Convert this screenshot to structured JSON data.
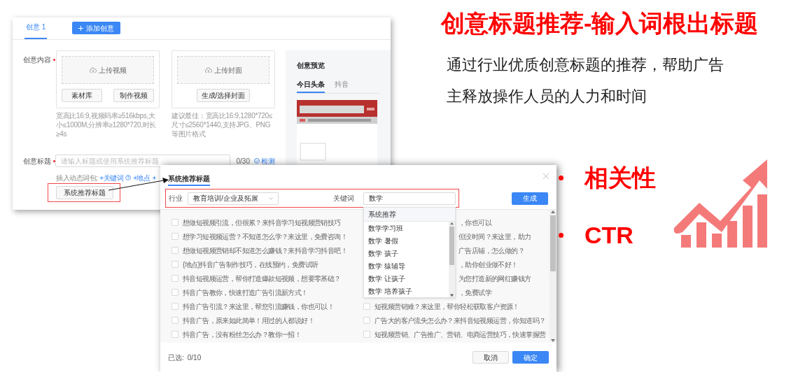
{
  "slide": {
    "title": "创意标题推荐-输入词根出标题",
    "description": "通过行业优质创意标题的推荐，帮助广告主释放操作人员的人力和时间",
    "bullets": [
      "相关性",
      "CTR"
    ]
  },
  "editor": {
    "tabs": [
      {
        "label": "创意 1",
        "selected": true
      }
    ],
    "add_button": "添加创意",
    "content_label": "创意内容",
    "content_required": true,
    "upload_cards": [
      {
        "upload_label": "上传视频",
        "buttons": [
          "素材库",
          "制作视频"
        ],
        "hint": "宽高比16:9,视频码率≥516kbps,大小≤1000M,分辨率≥1280*720,时长≥4s"
      },
      {
        "upload_label": "上传封面",
        "buttons": [
          "生成/选择封面"
        ],
        "hint": "建议最佳：宽高比16:9,1280*720≤尺寸≤2560*1440,支持JPG、PNG等图片格式"
      }
    ],
    "preview": {
      "title": "创意预览",
      "tabs": [
        {
          "label": "今日头条",
          "selected": true
        },
        {
          "label": "抖音",
          "selected": false
        }
      ]
    },
    "title_field": {
      "label": "创意标题",
      "required": true,
      "placeholder": "请输入标题或使用系统推荐标题",
      "counter": "0/30",
      "check_link": "检测"
    },
    "insert": {
      "label": "插入动态词包:",
      "links": [
        "+关键词",
        "+地点",
        "+"
      ]
    },
    "recommend_button": "系统推荐标题"
  },
  "dialog": {
    "title": "系统推荐标题",
    "industry_label": "行业",
    "industry_value": "教育培训/企业及拓展",
    "keyword_label": "关键词",
    "keyword_value": "数学",
    "generate_button": "生成",
    "suggestions": {
      "header": "系统推荐",
      "items": [
        "数学学习班",
        "数学 暑假",
        "数学 孩子",
        "数学 猿辅导",
        "数学 让孩子",
        "数学 培养孩子"
      ]
    },
    "titles_left": [
      {
        "text": "想做短视频引流，但很累？来抖音学习短视频营销技巧",
        "checked": false
      },
      {
        "text": "想学习短视频运营？不知道怎么学？来这里，免费咨询！",
        "checked": false
      },
      {
        "text": "想做短视频营销却不知道怎么赚钱？来抖音学习抖音吧！",
        "checked": false
      },
      {
        "text": "{地点}抖音广告制作技巧，在线预约，免费试听",
        "checked": false
      },
      {
        "text": "抖音短视频运营，帮你打造爆款短视频，想要零基础？",
        "checked": false
      },
      {
        "text": "抖音广告教你，快速打造广告引流新方式！",
        "checked": false
      },
      {
        "text": "抖音广告引流？来这里，帮您引流赚钱，你也可以！",
        "checked": false
      },
      {
        "text": "抖音广告，原来如此简单！用过的人都说好！",
        "checked": false
      },
      {
        "text": "抖音广告，没有粉丝怎么办？教你一招！",
        "checked": false
      }
    ],
    "titles_right": [
      {
        "text": "，你也可以",
        "covered": true
      },
      {
        "text": "但没时间？来这里，助力",
        "covered": true
      },
      {
        "text": "广告店铺，怎么做的？",
        "covered": true
      },
      {
        "text": "，助你创业做不好！",
        "covered": true
      },
      {
        "text": "为您打造新的网红赚钱方",
        "covered": true
      },
      {
        "text": "，免费试学",
        "covered": true
      },
      {
        "text": "短视频营销难？来这里，帮你轻松获取客户资源！",
        "covered": false,
        "checked": false
      },
      {
        "text": "广告大的客户流失怎么办？来抖音短视频运营，你知道吗？",
        "covered": false,
        "checked": false
      },
      {
        "text": "短视频营销、广告推广、营销、电商运营技巧，快速掌握营",
        "covered": false,
        "checked": false
      }
    ],
    "selected_label": "已选:",
    "selected_count": "0/10",
    "cancel_button": "取消",
    "ok_button": "确定"
  }
}
